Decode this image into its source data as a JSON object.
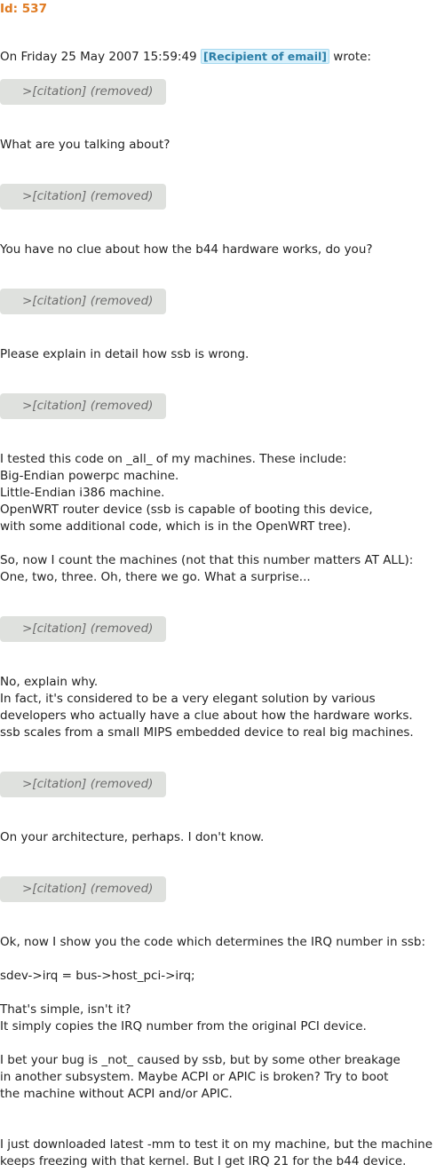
{
  "header": {
    "id_label": "Id: 537",
    "intro_before": "On Friday 25 May 2007 15:59:49",
    "recipient": "[Recipient of email]",
    "intro_after": "wrote:"
  },
  "citation_label": ">[citation] (removed)",
  "paragraphs": {
    "p1": [
      "What are you talking about?"
    ],
    "p2": [
      "You have no clue about how the b44 hardware works, do you?"
    ],
    "p3": [
      "Please explain in detail how ssb is wrong."
    ],
    "p4": [
      "I tested this code on _all_ of my machines. These include:",
      "Big-Endian powerpc machine.",
      "Little-Endian i386 machine.",
      "OpenWRT router device (ssb is capable of booting this device,",
      "with some additional code, which is in the OpenWRT tree)."
    ],
    "p5": [
      "So, now I count the machines (not that this number matters AT ALL):",
      "One, two, three. Oh, there we go. What a surprise..."
    ],
    "p6": [
      "No, explain why.",
      "In fact, it's considered to be a very elegant solution by various",
      "developers who actually have a clue about how the hardware works.",
      "ssb scales from a small MIPS embedded device to real big machines."
    ],
    "p7": [
      "On your architecture, perhaps. I don't know."
    ],
    "p8": [
      "Ok, now I show you the code which determines the IRQ number in ssb:"
    ],
    "p9": [
      "sdev->irq = bus->host_pci->irq;"
    ],
    "p10": [
      "That's simple, isn't it?",
      "It simply copies the IRQ number from the original PCI device."
    ],
    "p11": [
      "I bet your bug is _not_ caused by ssb, but by some other breakage",
      "in another subsystem. Maybe ACPI or APIC is broken? Try to boot",
      "the machine without ACPI and/or APIC."
    ],
    "p12": [
      "I just downloaded latest -mm to test it on my machine, but the machine",
      "keeps freezing with that kernel. But I get IRQ 21 for the b44 device."
    ]
  }
}
